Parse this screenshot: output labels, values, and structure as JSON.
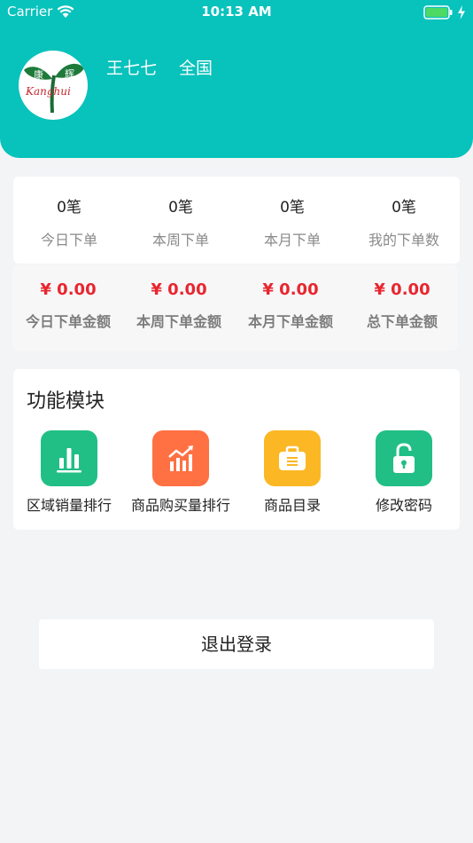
{
  "status_bar": {
    "carrier": "Carrier",
    "time": "10:13 AM"
  },
  "profile": {
    "name": "王七七",
    "region": "全国",
    "logo_text_top_left": "康",
    "logo_text_top_right": "辉",
    "logo_text_script": "Kanghui"
  },
  "order_stats": [
    {
      "value": "0笔",
      "label": "今日下单"
    },
    {
      "value": "0笔",
      "label": "本周下单"
    },
    {
      "value": "0笔",
      "label": "本月下单"
    },
    {
      "value": "0笔",
      "label": "我的下单数"
    }
  ],
  "amount_stats": [
    {
      "value": "¥ 0.00",
      "label": "今日下单金额"
    },
    {
      "value": "¥ 0.00",
      "label": "本周下单金额"
    },
    {
      "value": "¥ 0.00",
      "label": "本月下单金额"
    },
    {
      "value": "¥ 0.00",
      "label": "总下单金额"
    }
  ],
  "functions": {
    "title": "功能模块",
    "items": [
      {
        "label": "区域销量排行",
        "icon": "bar-chart-icon",
        "color": "#21bf85"
      },
      {
        "label": "商品购买量排行",
        "icon": "trend-chart-icon",
        "color": "#ff7043"
      },
      {
        "label": "商品目录",
        "icon": "briefcase-icon",
        "color": "#fbb724"
      },
      {
        "label": "修改密码",
        "icon": "unlock-icon",
        "color": "#21bf85"
      }
    ]
  },
  "logout_label": "退出登录",
  "colors": {
    "header": "#08c2bc",
    "money": "#e8262f"
  }
}
